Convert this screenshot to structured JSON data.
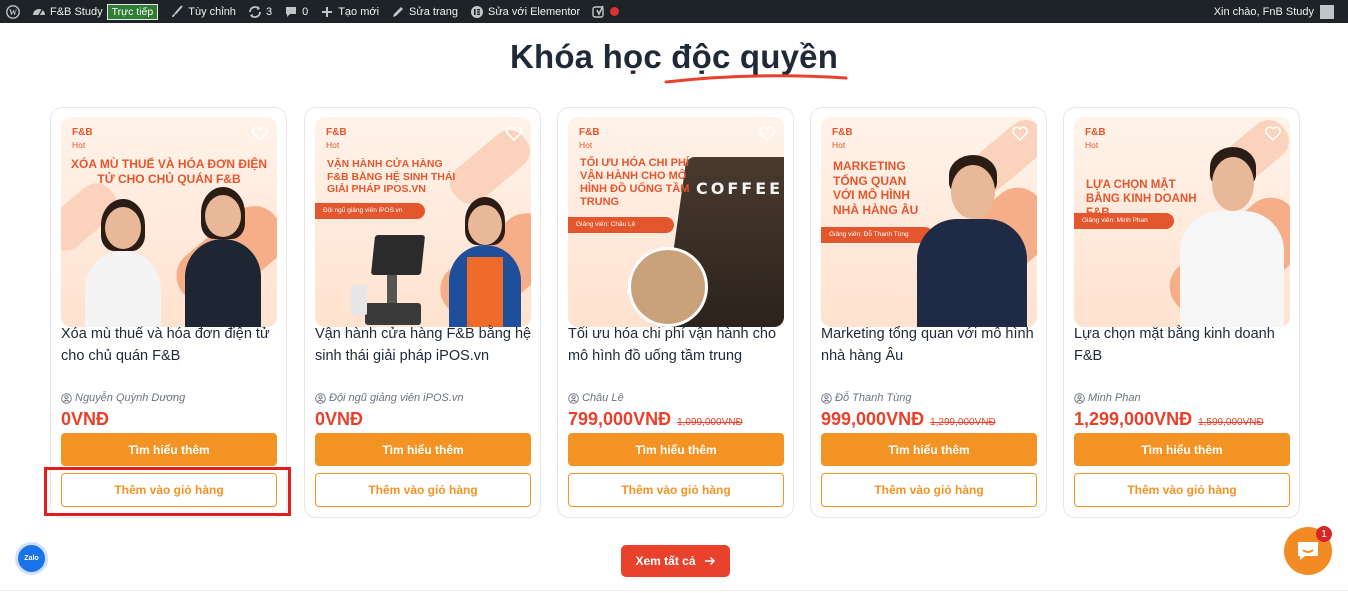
{
  "adminbar": {
    "site_name": "F&B Study",
    "live_label": "Trực tiếp",
    "customize": "Tùy chỉnh",
    "updates_count": "3",
    "comments_count": "0",
    "new_label": "Tạo mới",
    "edit_page": "Sửa trang",
    "edit_elementor": "Sửa với Elementor",
    "greeting": "Xin chào, FnB Study"
  },
  "section": {
    "title": "Khóa học độc quyền"
  },
  "courses": [
    {
      "thumb_brand": "F&B",
      "thumb_hot": "Hot",
      "thumb_headline": "Xóa mù thuế và hóa đơn điện tử cho chủ quán F&B",
      "title": "Xóa mù thuế và hóa đơn điện tử cho chủ quán F&B",
      "author": "Nguyễn Quỳnh Dương",
      "price": "0VNĐ",
      "old_price": "",
      "learn_more": "Tìm hiểu thêm",
      "add_to_cart": "Thêm vào giỏ hàng"
    },
    {
      "thumb_brand": "F&B",
      "thumb_hot": "Hot",
      "thumb_headline": "Vận hành cửa hàng F&B bằng hệ sinh thái giải pháp iPOS.vn",
      "thumb_pill": "Đội ngũ giảng viên iPOS.vn",
      "title": "Vận hành cửa hàng F&B bằng hệ sinh thái giải pháp iPOS.vn",
      "author": "Đội ngũ giảng viên iPOS.vn",
      "price": "0VNĐ",
      "old_price": "",
      "learn_more": "Tìm hiểu thêm",
      "add_to_cart": "Thêm vào giỏ hàng"
    },
    {
      "thumb_brand": "F&B",
      "thumb_hot": "Hot",
      "thumb_headline": "Tối ưu hóa chi phí vận hành cho mô hình đồ uống tầm trung",
      "thumb_pill": "Giảng viên: Châu Lê",
      "thumb_sign": "COFFEE",
      "title": "Tối ưu hóa chi phí vận hành cho mô hình đồ uống tầm trung",
      "author": "Châu Lê",
      "price": "799,000VNĐ",
      "old_price": "1,099,000VNĐ",
      "learn_more": "Tìm hiểu thêm",
      "add_to_cart": "Thêm vào giỏ hàng"
    },
    {
      "thumb_brand": "F&B",
      "thumb_hot": "Hot",
      "thumb_headline": "Marketing tổng quan với mô hình nhà hàng Âu",
      "thumb_pill": "Giảng viên: Đỗ Thanh Tùng",
      "title": "Marketing tổng quan với mô hình nhà hàng Âu",
      "author": "Đỗ Thanh Tùng",
      "price": "999,000VNĐ",
      "old_price": "1,299,000VNĐ",
      "learn_more": "Tìm hiểu thêm",
      "add_to_cart": "Thêm vào giỏ hàng"
    },
    {
      "thumb_brand": "F&B",
      "thumb_hot": "Hot",
      "thumb_headline": "Lựa chọn mặt bằng kinh doanh F&B",
      "thumb_pill": "Giảng viên: Minh Phan",
      "title": "Lựa chọn mặt bằng kinh doanh F&B",
      "author": "Minh Phan",
      "price": "1,299,000VNĐ",
      "old_price": "1,599,000VNĐ",
      "learn_more": "Tìm hiểu thêm",
      "add_to_cart": "Thêm vào giỏ hàng"
    }
  ],
  "see_all": "Xem tất cả",
  "zalo_label": "Zalo",
  "chat_badge": "1",
  "colors": {
    "accent_orange": "#f39324",
    "price_red": "#e8412c",
    "highlight_red": "#e11d1d"
  }
}
